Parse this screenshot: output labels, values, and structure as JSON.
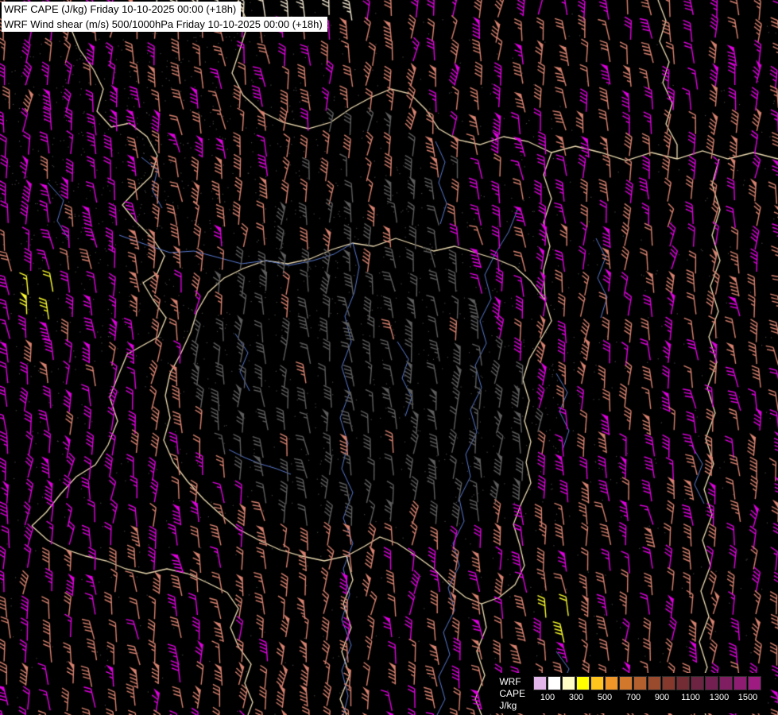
{
  "title_box": {
    "line1": "WRF CAPE (J/kg) Friday 10-10-2025 00:00 (+18h)",
    "line2": "WRF Wind shear (m/s) 500/1000hPa Friday 10-10-2025 00:00 (+18h)"
  },
  "legend": {
    "model_label": "WRF",
    "field_label": "CAPE",
    "units_label": "J/kg",
    "tick_labels": [
      "100",
      "300",
      "500",
      "700",
      "900",
      "1100",
      "1300",
      "1500"
    ],
    "scale_colors": [
      "#e2b6e8",
      "#ffffff",
      "#fffbc4",
      "#ffff00",
      "#ffc41e",
      "#f09628",
      "#d2782d",
      "#b45f2e",
      "#9a4b2e",
      "#85392c",
      "#742c34",
      "#6c2442",
      "#741f52",
      "#801e62",
      "#8e1d72",
      "#9e1c82"
    ]
  },
  "map": {
    "background_color": "#000000",
    "border_color": "#eedcb2",
    "river_color": "#5a7ad0",
    "terrain_dot_color": "#484848",
    "barb_palette": {
      "magenta": "#e000e0",
      "salmon": "#d98270",
      "dark_gray": "#5e5e5e",
      "pale": "#eee2cc",
      "yellow": "#ffff2e"
    }
  }
}
